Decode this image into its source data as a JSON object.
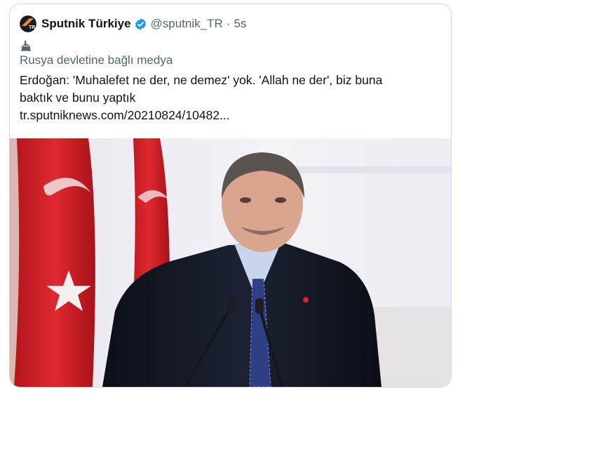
{
  "tweet": {
    "display_name": "Sputnik Türkiye",
    "handle": "@sputnik_TR",
    "separator": "·",
    "time": "5s",
    "avatar_badge": "TR",
    "state_media_label": "Rusya devletine bağlı medya",
    "text_line1": "Erdoğan: 'Muhalefet ne der, ne demez' yok. 'Allah ne der', biz buna",
    "text_line2": "baktık ve bunu yaptık",
    "link": "tr.sputniknews.com/20210824/10482...",
    "icons": {
      "avatar": "sputnik-logo-icon",
      "verified": "verified-badge-icon",
      "state_media": "government-building-icon"
    },
    "colors": {
      "verified": "#1d9bf0",
      "secondary_text": "#536471",
      "flag_red": "#d8232a",
      "avatar_orange": "#f28c28"
    }
  }
}
